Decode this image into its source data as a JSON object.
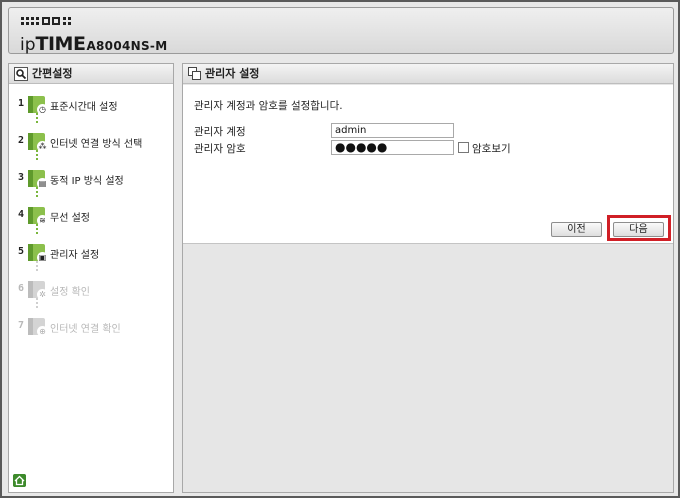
{
  "header": {
    "brand_ip": "ip",
    "brand_time": "TIME",
    "model": "A8004NS-M"
  },
  "sidebar": {
    "title": "간편설정",
    "title_icon": "magnifier-icon",
    "steps": [
      {
        "num": "1",
        "label": "표준시간대 설정",
        "icon": "clock-icon",
        "enabled": true
      },
      {
        "num": "2",
        "label": "인터넷 연결 방식 선택",
        "icon": "network-icon",
        "enabled": true
      },
      {
        "num": "3",
        "label": "동적 IP 방식 설정",
        "icon": "ip-icon",
        "enabled": true
      },
      {
        "num": "4",
        "label": "무선 설정",
        "icon": "wireless-icon",
        "enabled": true
      },
      {
        "num": "5",
        "label": "관리자 설정",
        "icon": "lock-icon",
        "enabled": true
      },
      {
        "num": "6",
        "label": "설정 확인",
        "icon": "gear-icon",
        "enabled": false
      },
      {
        "num": "7",
        "label": "인터넷 연결 확인",
        "icon": "globe-icon",
        "enabled": false
      }
    ],
    "home_icon": "home-icon"
  },
  "main": {
    "title": "관리자 설정",
    "title_icon": "window-icon",
    "description": "관리자 계정과 암호를 설정합니다.",
    "account_label": "관리자 계정",
    "account_value": "admin",
    "password_label": "관리자 암호",
    "password_masked": "●●●●●",
    "show_password_label": "암호보기",
    "show_password_checked": false,
    "prev_button": "이전",
    "next_button": "다음",
    "highlight_color": "#d01f26"
  }
}
